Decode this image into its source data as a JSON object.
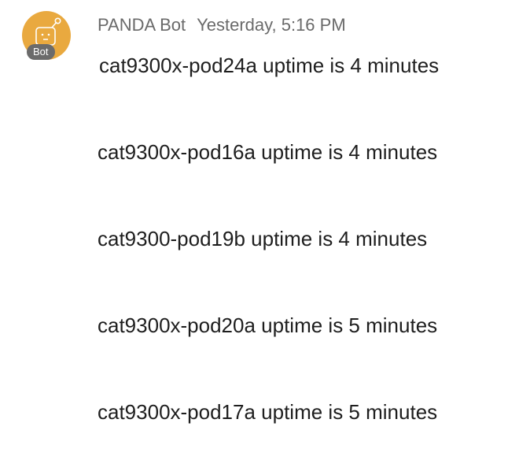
{
  "post": {
    "sender": "PANDA Bot",
    "timestamp": "Yesterday, 5:16 PM",
    "badge": "Bot",
    "avatar_color": "#e9a93f",
    "avatar_icon": "robot-face-icon",
    "messages": [
      "cat9300x-pod24a uptime is 4 minutes",
      "cat9300x-pod16a uptime is 4 minutes",
      "cat9300-pod19b uptime is 4 minutes",
      "cat9300x-pod20a uptime is 5 minutes",
      "cat9300x-pod17a uptime is 5 minutes"
    ]
  }
}
